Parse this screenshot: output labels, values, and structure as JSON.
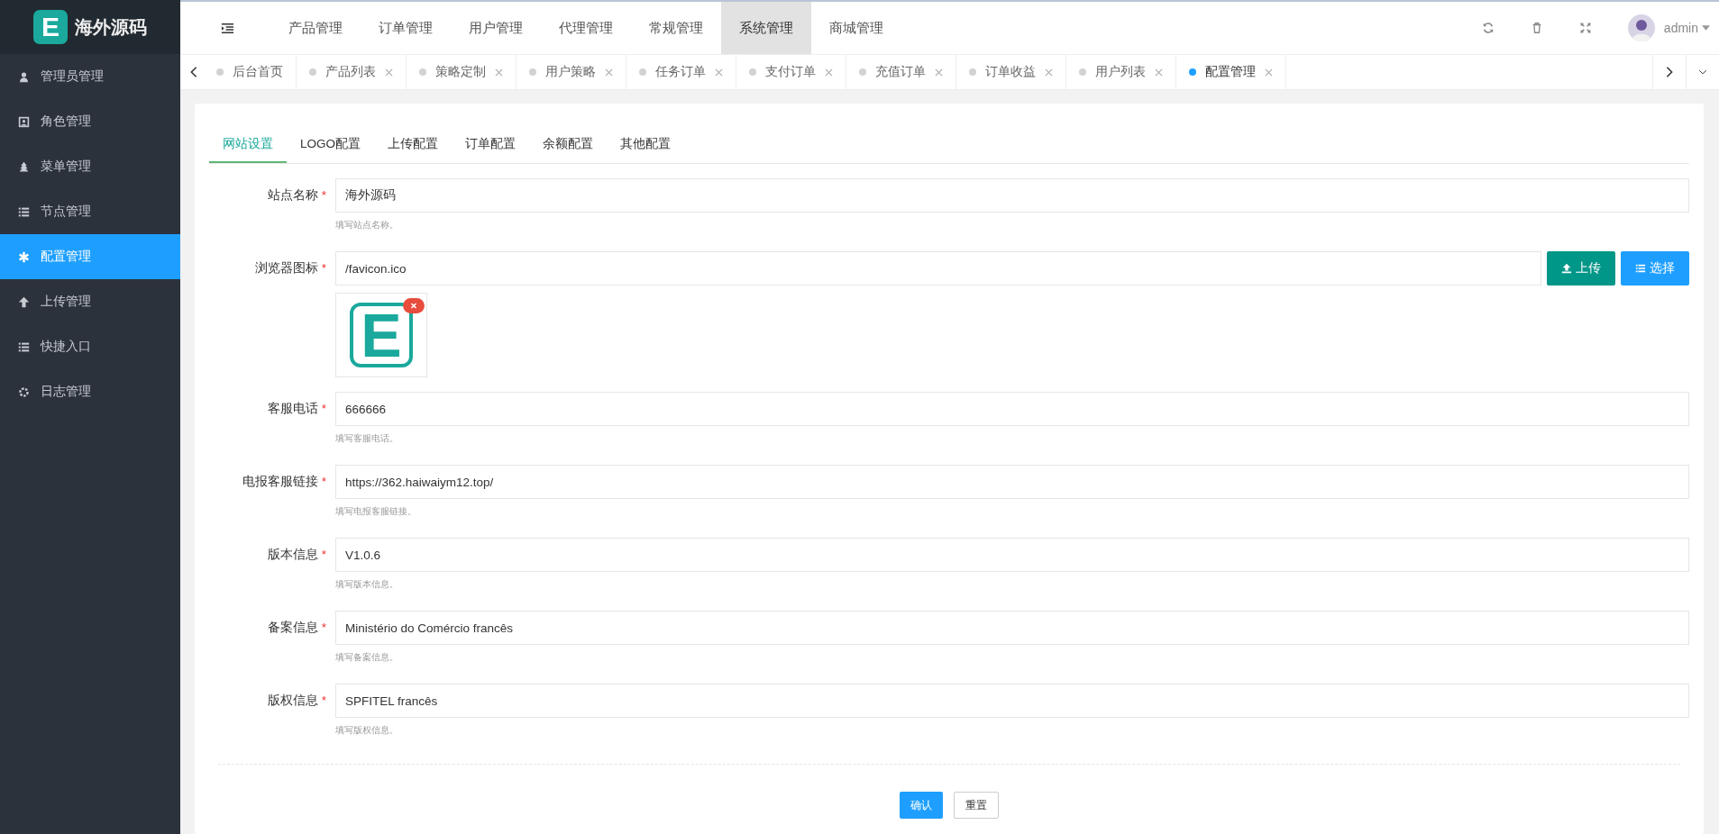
{
  "logo": {
    "mark": "E",
    "name": "海外源码"
  },
  "sidebar": {
    "items": [
      {
        "label": "管理员管理",
        "selected": false
      },
      {
        "label": "角色管理",
        "selected": false
      },
      {
        "label": "菜单管理",
        "selected": false
      },
      {
        "label": "节点管理",
        "selected": false
      },
      {
        "label": "配置管理",
        "selected": true
      },
      {
        "label": "上传管理",
        "selected": false
      },
      {
        "label": "快捷入口",
        "selected": false
      },
      {
        "label": "日志管理",
        "selected": false
      }
    ]
  },
  "top_nav": [
    {
      "label": "产品管理",
      "selected": false
    },
    {
      "label": "订单管理",
      "selected": false
    },
    {
      "label": "用户管理",
      "selected": false
    },
    {
      "label": "代理管理",
      "selected": false
    },
    {
      "label": "常规管理",
      "selected": false
    },
    {
      "label": "系统管理",
      "selected": true
    },
    {
      "label": "商城管理",
      "selected": false
    }
  ],
  "user": {
    "name": "admin"
  },
  "page_tabs": [
    {
      "label": "后台首页",
      "selected": false,
      "closable": false
    },
    {
      "label": "产品列表",
      "selected": false,
      "closable": true
    },
    {
      "label": "策略定制",
      "selected": false,
      "closable": true
    },
    {
      "label": "用户策略",
      "selected": false,
      "closable": true
    },
    {
      "label": "任务订单",
      "selected": false,
      "closable": true
    },
    {
      "label": "支付订单",
      "selected": false,
      "closable": true
    },
    {
      "label": "充值订单",
      "selected": false,
      "closable": true
    },
    {
      "label": "订单收益",
      "selected": false,
      "closable": true
    },
    {
      "label": "用户列表",
      "selected": false,
      "closable": true
    },
    {
      "label": "配置管理",
      "selected": true,
      "closable": true
    }
  ],
  "form_tabs": [
    {
      "label": "网站设置",
      "selected": true
    },
    {
      "label": "LOGO配置",
      "selected": false
    },
    {
      "label": "上传配置",
      "selected": false
    },
    {
      "label": "订单配置",
      "selected": false
    },
    {
      "label": "余额配置",
      "selected": false
    },
    {
      "label": "其他配置",
      "selected": false
    }
  ],
  "fields": [
    {
      "kind": "text",
      "label": "站点名称",
      "required": true,
      "value": "海外源码",
      "hint": "填写站点名称。"
    },
    {
      "kind": "image",
      "label": "浏览器图标",
      "required": true,
      "value": "/favicon.ico",
      "buttons": [
        "上传",
        "选择"
      ],
      "preview": {
        "mark": "E"
      }
    },
    {
      "kind": "text",
      "label": "客服电话",
      "required": true,
      "value": "666666",
      "hint": "填写客服电话。"
    },
    {
      "kind": "text",
      "label": "电报客服链接",
      "required": true,
      "value": "https://362.haiwaiym12.top/",
      "hint": "填写电报客服链接。"
    },
    {
      "kind": "text",
      "label": "版本信息",
      "required": true,
      "value": "V1.0.6",
      "hint": "填写版本信息。"
    },
    {
      "kind": "text",
      "label": "备案信息",
      "required": true,
      "value": "Ministério do Comércio francês",
      "hint": "填写备案信息。"
    },
    {
      "kind": "text",
      "label": "版权信息",
      "required": true,
      "value": "SPFITEL francês",
      "hint": "填写版权信息。"
    }
  ],
  "required_mark": "*",
  "actions": {
    "submit": "确认",
    "reset": "重置"
  }
}
